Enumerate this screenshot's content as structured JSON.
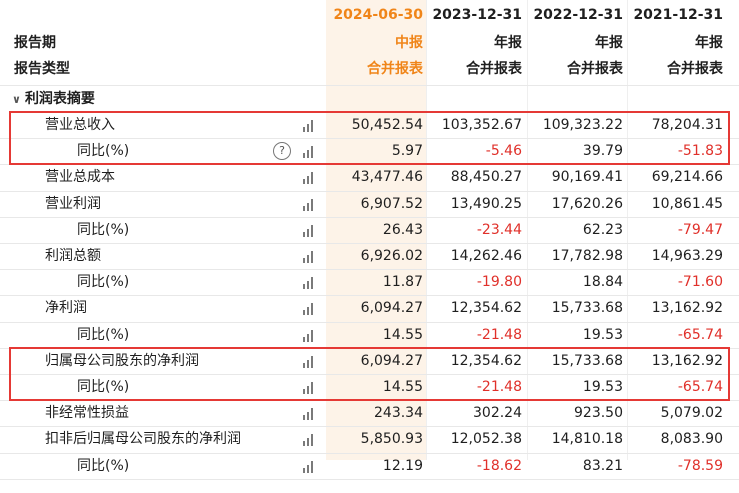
{
  "columns": [
    {
      "date": "2024-06-30",
      "period": "中报",
      "type": "合并报表"
    },
    {
      "date": "2023-12-31",
      "period": "年报",
      "type": "合并报表"
    },
    {
      "date": "2022-12-31",
      "period": "年报",
      "type": "合并报表"
    },
    {
      "date": "2021-12-31",
      "period": "年报",
      "type": "合并报表"
    }
  ],
  "header_labels": {
    "period": "报告期",
    "type": "报告类型"
  },
  "section": {
    "title": "利润表摘要",
    "toggle_icon": "chevron-down-icon"
  },
  "rows": [
    {
      "label": "营业总收入",
      "values": [
        "50,452.54",
        "103,352.67",
        "109,323.22",
        "78,204.31"
      ]
    },
    {
      "label": "同比(%)",
      "values": [
        "5.97",
        "-5.46",
        "39.79",
        "-51.83"
      ],
      "help": "?"
    },
    {
      "label": "营业总成本",
      "values": [
        "43,477.46",
        "88,450.27",
        "90,169.41",
        "69,214.66"
      ]
    },
    {
      "label": "营业利润",
      "values": [
        "6,907.52",
        "13,490.25",
        "17,620.26",
        "10,861.45"
      ]
    },
    {
      "label": "同比(%)",
      "values": [
        "26.43",
        "-23.44",
        "62.23",
        "-79.47"
      ]
    },
    {
      "label": "利润总额",
      "values": [
        "6,926.02",
        "14,262.46",
        "17,782.98",
        "14,963.29"
      ]
    },
    {
      "label": "同比(%)",
      "values": [
        "11.87",
        "-19.80",
        "18.84",
        "-71.60"
      ]
    },
    {
      "label": "净利润",
      "values": [
        "6,094.27",
        "12,354.62",
        "15,733.68",
        "13,162.92"
      ]
    },
    {
      "label": "同比(%)",
      "values": [
        "14.55",
        "-21.48",
        "19.53",
        "-65.74"
      ]
    },
    {
      "label": "归属母公司股东的净利润",
      "values": [
        "6,094.27",
        "12,354.62",
        "15,733.68",
        "13,162.92"
      ]
    },
    {
      "label": "同比(%)",
      "values": [
        "14.55",
        "-21.48",
        "19.53",
        "-65.74"
      ]
    },
    {
      "label": "非经常性损益",
      "values": [
        "243.34",
        "302.24",
        "923.50",
        "5,079.02"
      ]
    },
    {
      "label": "扣非后归属母公司股东的净利润",
      "values": [
        "5,850.93",
        "12,052.38",
        "14,810.18",
        "8,083.90"
      ]
    },
    {
      "label": "同比(%)",
      "values": [
        "12.19",
        "-18.62",
        "83.21",
        "-78.59"
      ]
    }
  ],
  "colors": {
    "accent": "#f08519",
    "negative": "#e0302a",
    "highlight_box": "#e53935",
    "current_col_bg": "#fdf3e8"
  }
}
